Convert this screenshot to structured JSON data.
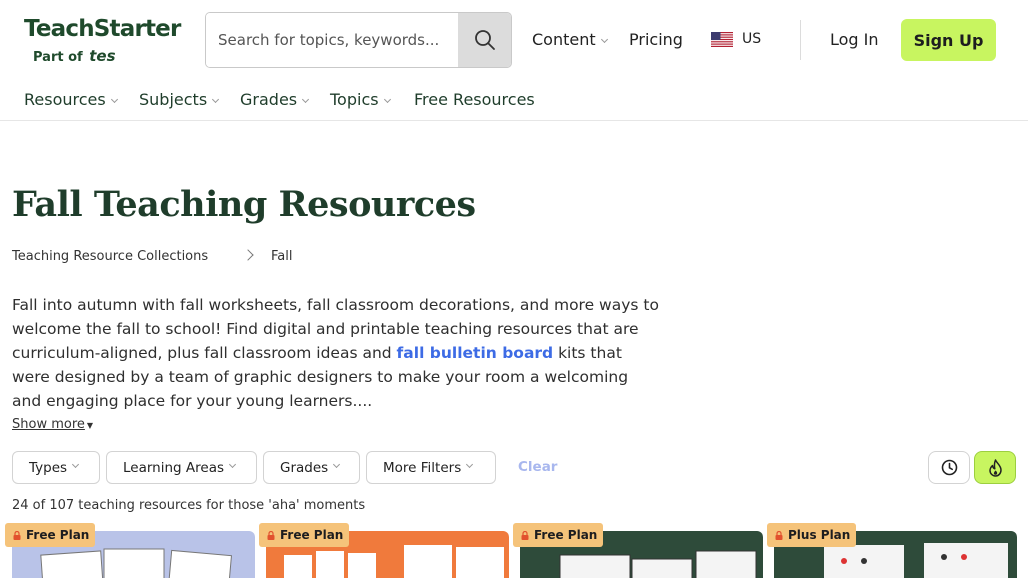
{
  "header": {
    "logo_text": "TeachStarter",
    "logo_sub": "Part of",
    "logo_sub_brand": "tes",
    "search_placeholder": "Search for topics, keywords...",
    "nav": {
      "content": "Content",
      "pricing": "Pricing",
      "region": "US",
      "login": "Log In",
      "signup": "Sign Up"
    }
  },
  "subnav": [
    "Resources",
    "Subjects",
    "Grades",
    "Topics",
    "Free Resources"
  ],
  "page": {
    "title": "Fall Teaching Resources",
    "breadcrumb": [
      "Teaching Resource Collections",
      "Fall"
    ],
    "description_before": "Fall into autumn with fall worksheets, fall classroom decorations, and more ways to welcome the fall to school! Find digital and printable teaching resources that are curriculum-aligned, plus fall classroom ideas and ",
    "description_link": "fall bulletin board",
    "description_after": " kits that were designed by a team of graphic designers to make your room a welcoming and engaging place for your young learners....",
    "show_more": "Show more"
  },
  "filters": {
    "types": "Types",
    "learning_areas": "Learning Areas",
    "grades": "Grades",
    "more_filters": "More Filters",
    "clear": "Clear"
  },
  "results": {
    "count_text": "24 of 107 teaching resources for those 'aha' moments"
  },
  "cards": [
    {
      "badge": "Free Plan",
      "color": "#b9c3e8"
    },
    {
      "badge": "Free Plan",
      "color": "#f07a3c"
    },
    {
      "badge": "Free Plan",
      "color": "#2e4b3a"
    },
    {
      "badge": "Plus Plan",
      "color": "#2e4b3a"
    }
  ],
  "colors": {
    "brand_green": "#1f3d2b",
    "signup_bg": "#c8f560",
    "link_blue": "#3d6be5",
    "badge_bg": "#f5c37a"
  }
}
